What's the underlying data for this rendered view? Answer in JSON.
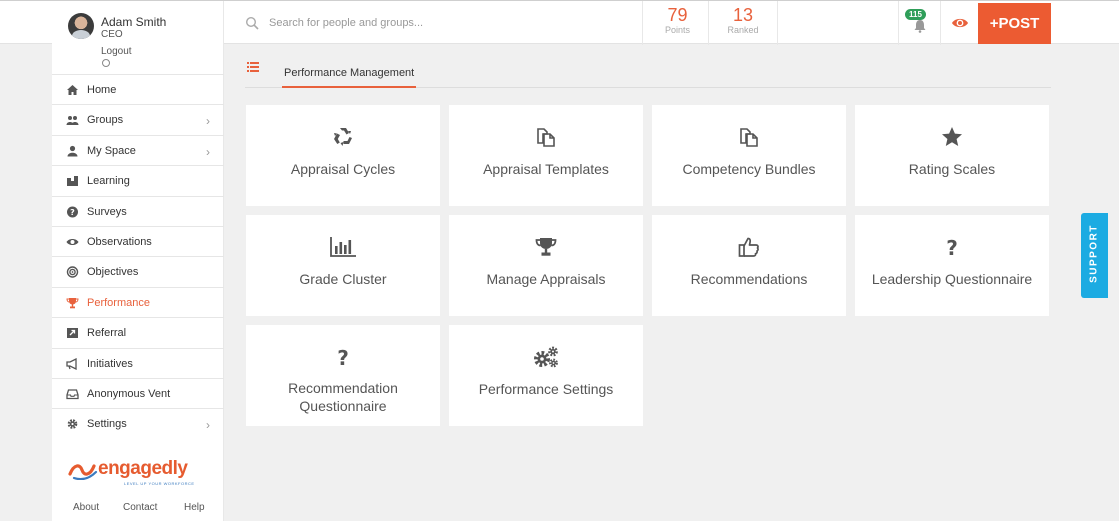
{
  "user": {
    "name": "Adam Smith",
    "role": "CEO",
    "logout_label": "Logout"
  },
  "search": {
    "placeholder": "Search for people and groups..."
  },
  "stats": {
    "points": {
      "value": "79",
      "label": "Points"
    },
    "ranked": {
      "value": "13",
      "label": "Ranked"
    }
  },
  "notifications": {
    "count": "115"
  },
  "post_button": {
    "label": "+POST"
  },
  "sidebar": {
    "items": [
      {
        "label": "Home",
        "icon": "home-icon"
      },
      {
        "label": "Groups",
        "icon": "groups-icon",
        "chevron": "›"
      },
      {
        "label": "My Space",
        "icon": "user-icon",
        "chevron": "›"
      },
      {
        "label": "Learning",
        "icon": "learning-icon"
      },
      {
        "label": "Surveys",
        "icon": "question-circle-icon"
      },
      {
        "label": "Observations",
        "icon": "eye-icon"
      },
      {
        "label": "Objectives",
        "icon": "target-icon"
      },
      {
        "label": "Performance",
        "icon": "trophy-icon",
        "active": true
      },
      {
        "label": "Referral",
        "icon": "referral-icon"
      },
      {
        "label": "Initiatives",
        "icon": "megaphone-icon"
      },
      {
        "label": "Anonymous Vent",
        "icon": "inbox-icon"
      },
      {
        "label": "Settings",
        "icon": "gear-icon",
        "chevron": "›"
      }
    ]
  },
  "brand": {
    "name": "engagedly",
    "tagline": "LEVEL UP YOUR WORKFORCE"
  },
  "footer": {
    "about": "About",
    "contact": "Contact",
    "help": "Help"
  },
  "tabs": {
    "active": "Performance Management"
  },
  "cards": [
    {
      "label": "Appraisal Cycles",
      "icon": "recycle-icon"
    },
    {
      "label": "Appraisal Templates",
      "icon": "copy-icon"
    },
    {
      "label": "Competency Bundles",
      "icon": "copy-icon"
    },
    {
      "label": "Rating Scales",
      "icon": "star-icon"
    },
    {
      "label": "Grade Cluster",
      "icon": "bar-chart-icon"
    },
    {
      "label": "Manage Appraisals",
      "icon": "trophy-icon"
    },
    {
      "label": "Recommendations",
      "icon": "thumbs-up-icon"
    },
    {
      "label": "Leadership Questionnaire",
      "icon": "question-icon"
    },
    {
      "label": "Recommendation Questionnaire",
      "icon": "question-icon"
    },
    {
      "label": "Performance Settings",
      "icon": "gears-icon"
    }
  ],
  "support": {
    "label": "SUPPORT"
  },
  "colors": {
    "accent": "#ec5b32",
    "support": "#1cabe2",
    "badge": "#2f9e59"
  }
}
